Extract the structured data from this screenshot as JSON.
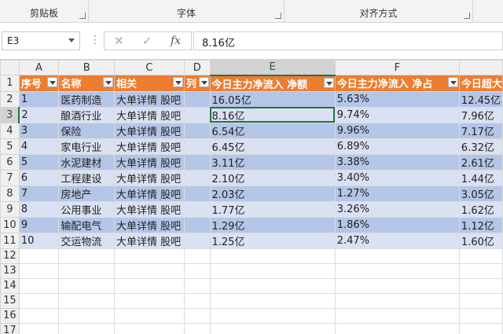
{
  "ribbon": {
    "groups": [
      "剪贴板",
      "字体",
      "对齐方式"
    ]
  },
  "formula_bar": {
    "name_box": "E3",
    "cancel_icon": "✕",
    "enter_icon": "✓",
    "fx_label": "fx",
    "value": "8.16亿"
  },
  "sheet": {
    "columns": [
      "A",
      "B",
      "C",
      "D",
      "E",
      "F",
      ""
    ],
    "row_numbers": [
      "1",
      "2",
      "3",
      "4",
      "5",
      "6",
      "7",
      "8",
      "9",
      "10",
      "11",
      "12",
      "13",
      "14",
      "15",
      "16",
      "17"
    ],
    "headers": [
      "序号",
      "名称",
      "相关",
      "列",
      "今日主力净流入 净额",
      "今日主力净流入 净占",
      "今日超大"
    ],
    "rows": [
      [
        "1",
        "医药制造",
        "大单详情 股吧",
        "",
        "16.05亿",
        "5.63%",
        "12.45亿"
      ],
      [
        "2",
        "酿酒行业",
        "大单详情 股吧",
        "",
        "8.16亿",
        "9.74%",
        "7.96亿"
      ],
      [
        "3",
        "保险",
        "大单详情 股吧",
        "",
        "6.54亿",
        "9.96%",
        "7.17亿"
      ],
      [
        "4",
        "家电行业",
        "大单详情 股吧",
        "",
        "6.45亿",
        "6.89%",
        "6.32亿"
      ],
      [
        "5",
        "水泥建材",
        "大单详情 股吧",
        "",
        "3.11亿",
        "3.38%",
        "2.61亿"
      ],
      [
        "6",
        "工程建设",
        "大单详情 股吧",
        "",
        "2.10亿",
        "3.40%",
        "1.44亿"
      ],
      [
        "7",
        "房地产",
        "大单详情 股吧",
        "",
        "2.03亿",
        "1.27%",
        "3.05亿"
      ],
      [
        "8",
        "公用事业",
        "大单详情 股吧",
        "",
        "1.77亿",
        "3.26%",
        "1.62亿"
      ],
      [
        "9",
        "输配电气",
        "大单详情 股吧",
        "",
        "1.29亿",
        "1.86%",
        "1.12亿"
      ],
      [
        "10",
        "交运物流",
        "大单详情 股吧",
        "",
        "1.25亿",
        "2.47%",
        "1.60亿"
      ]
    ]
  },
  "colors": {
    "header_fill": "#ed7d31",
    "band_dark": "#b4c6e7",
    "band_light": "#d9e1f2",
    "selection": "#217346"
  }
}
